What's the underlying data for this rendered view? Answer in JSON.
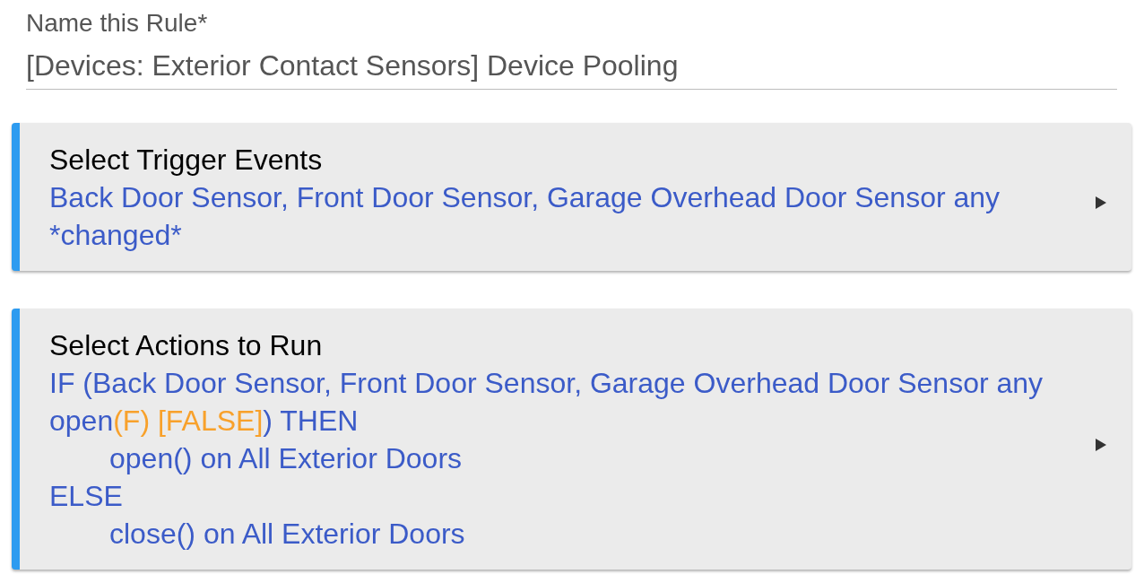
{
  "rule_name": {
    "label": "Name this Rule*",
    "value": "[Devices: Exterior Contact Sensors] Device Pooling"
  },
  "sections": [
    {
      "title": "Select Trigger Events",
      "lines": [
        {
          "segments": [
            {
              "kind": "plain",
              "text": "Back Door Sensor, Front Door Sensor, Garage Overhead Door Sensor any *changed*"
            }
          ]
        }
      ]
    },
    {
      "title": "Select Actions to Run",
      "lines": [
        {
          "segments": [
            {
              "kind": "plain",
              "text": "IF (Back Door Sensor, Front Door Sensor, Garage Overhead Door Sensor any open"
            },
            {
              "kind": "evaluation",
              "text": "(F) [FALSE]"
            },
            {
              "kind": "plain",
              "text": ") THEN"
            }
          ],
          "children": [
            {
              "segments": [
                {
                  "kind": "plain",
                  "text": "open() on All Exterior Doors"
                }
              ]
            }
          ]
        },
        {
          "segments": [
            {
              "kind": "plain",
              "text": "ELSE"
            }
          ],
          "children": [
            {
              "segments": [
                {
                  "kind": "plain",
                  "text": "close() on All Exterior Doors"
                }
              ]
            }
          ]
        }
      ]
    }
  ]
}
